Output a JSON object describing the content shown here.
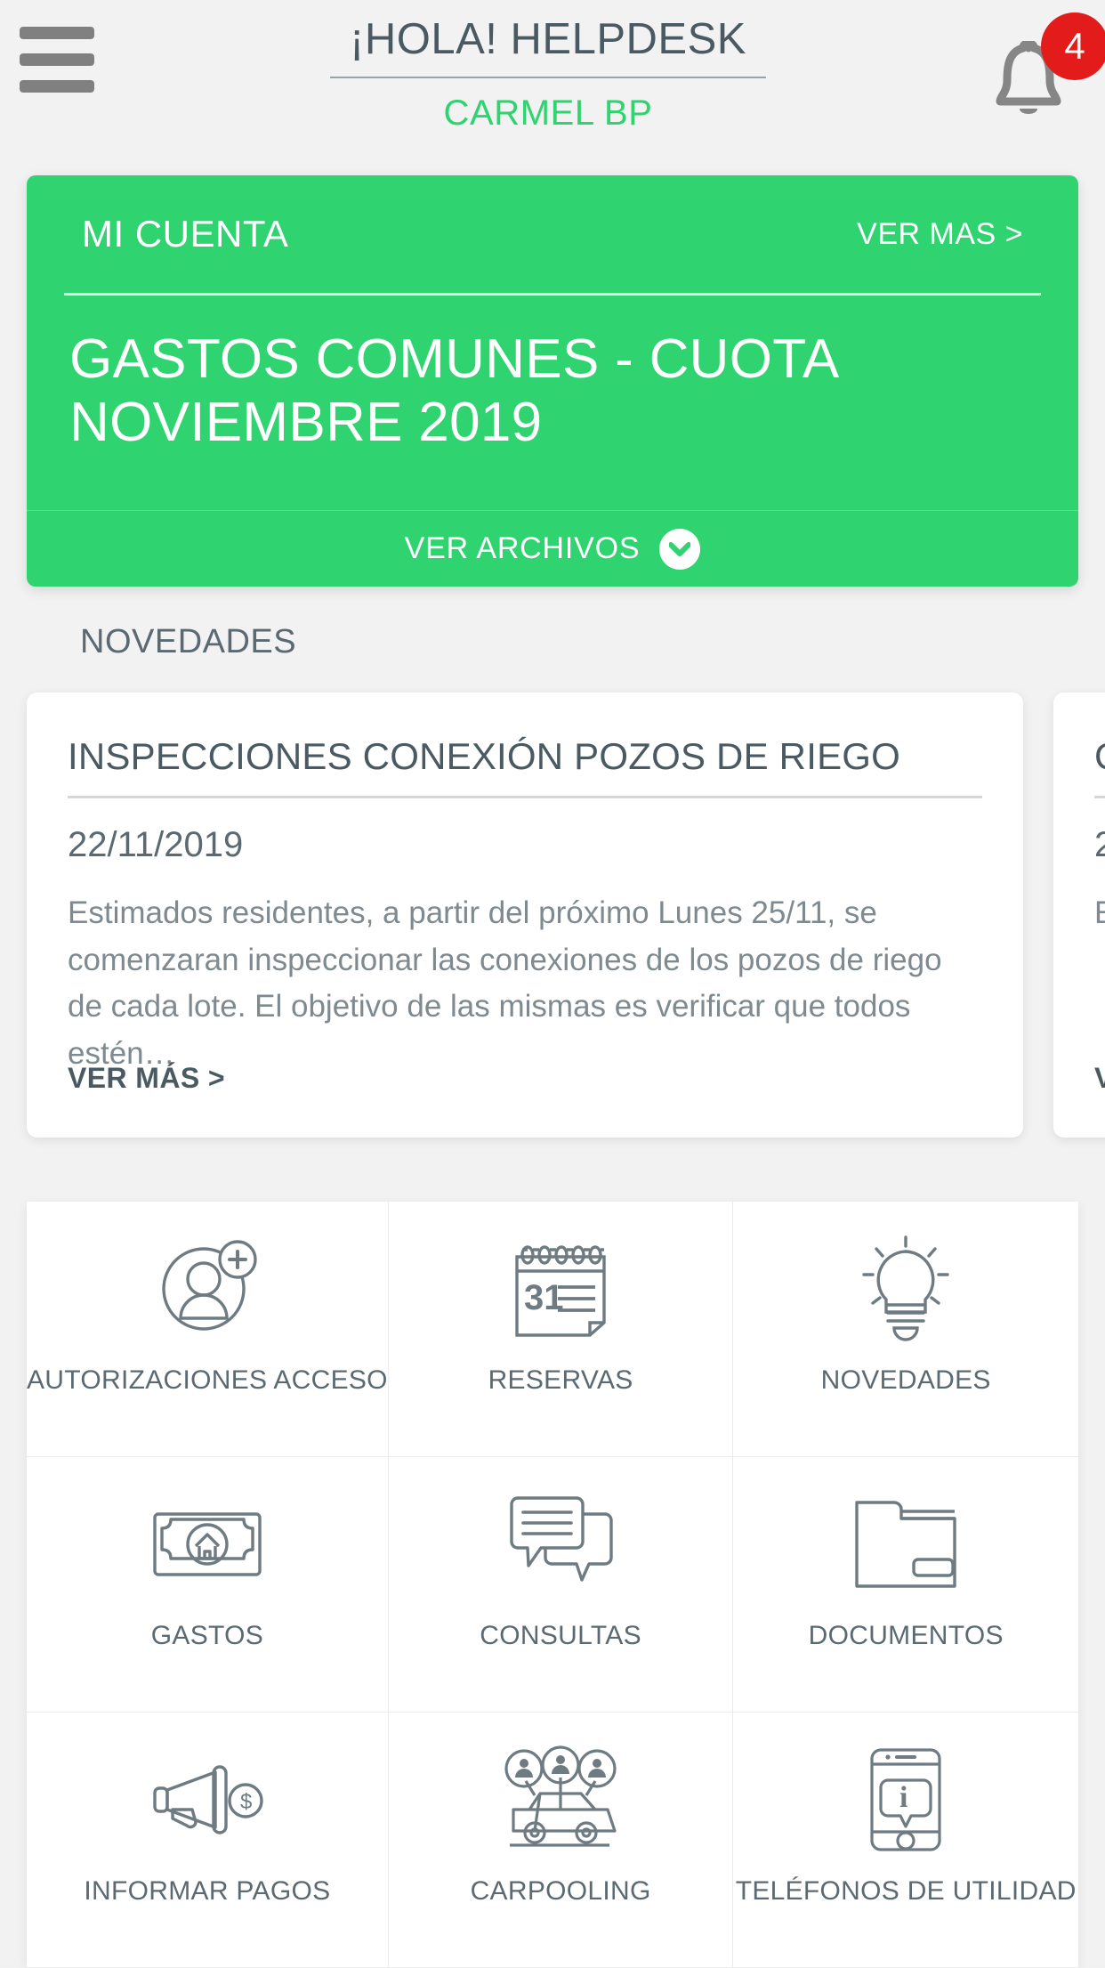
{
  "header": {
    "menu_icon": "hamburger-icon",
    "app_title": "¡HOLA! HELPDESK",
    "org_title": "CARMEL BP",
    "bell_icon": "bell-icon",
    "notification_count": "4"
  },
  "account_card": {
    "label": "MI CUENTA",
    "more_label": "VER MAS >",
    "headline": "GASTOS COMUNES - CUOTA NOVIEMBRE 2019",
    "footer_label": "VER ARCHIVOS",
    "chevron_icon": "chevron-down-icon",
    "background_color": "#2fd36f"
  },
  "news": {
    "section_title": "NOVEDADES",
    "items": [
      {
        "title": "INSPECCIONES CONEXIÓN POZOS DE RIEGO",
        "date": "22/11/2019",
        "body": "Estimados residentes, a partir del próximo Lunes 25/11, se comenzaran inspeccionar las conexiones de los pozos de riego de cada lote. El objetivo de las mismas es verificar que todos estén…",
        "more_label": "VER MÁS >"
      },
      {
        "title": "C",
        "date": "2",
        "body": "E r i",
        "more_label": "V"
      }
    ]
  },
  "menu_grid": {
    "tiles": [
      {
        "label": "AUTORIZACIONES ACCESO",
        "icon": "person-add-icon"
      },
      {
        "label": "RESERVAS",
        "icon": "calendar-31-icon"
      },
      {
        "label": "NOVEDADES",
        "icon": "lightbulb-icon"
      },
      {
        "label": "GASTOS",
        "icon": "banknote-house-icon"
      },
      {
        "label": "CONSULTAS",
        "icon": "chat-bubbles-icon"
      },
      {
        "label": "DOCUMENTOS",
        "icon": "folder-icon"
      },
      {
        "label": "INFORMAR PAGOS",
        "icon": "megaphone-dollar-icon"
      },
      {
        "label": "CARPOOLING",
        "icon": "car-people-icon"
      },
      {
        "label": "TELÉFONOS DE UTILIDAD",
        "icon": "phone-info-icon"
      }
    ]
  },
  "colors": {
    "accent_green": "#2fd36f",
    "badge_red": "#e31b1b",
    "text_slate": "#5b6a72",
    "icon_stroke": "#6e7b82"
  }
}
